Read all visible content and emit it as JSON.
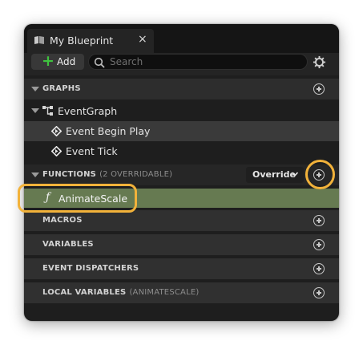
{
  "tab": {
    "title": "My Blueprint",
    "close": "×",
    "icon": "blueprint-icon"
  },
  "toolbar": {
    "add_icon": "+",
    "add_label": "Add",
    "search_placeholder": "Search",
    "search_value": "",
    "settings_icon": "gear-icon"
  },
  "sections": {
    "graphs": {
      "title": "GRAPHS"
    },
    "event_graph": {
      "label": "EventGraph"
    },
    "events": [
      {
        "label": "Event Begin Play"
      },
      {
        "label": "Event Tick"
      }
    ],
    "functions": {
      "title": "FUNCTIONS",
      "subtitle": "(2 OVERRIDABLE)",
      "override_label": "Override"
    },
    "function_items": [
      {
        "icon": "ƒ",
        "label": "AnimateScale"
      }
    ],
    "macros": {
      "title": "MACROS"
    },
    "variables": {
      "title": "VARIABLES"
    },
    "event_dispatchers": {
      "title": "EVENT DISPATCHERS"
    },
    "local_variables": {
      "title": "LOCAL VARIABLES",
      "subtitle": "(ANIMATESCALE)"
    }
  },
  "colors": {
    "highlight": "#f2b23a",
    "function_row": "#667a51",
    "add_plus": "#3fc33f"
  }
}
